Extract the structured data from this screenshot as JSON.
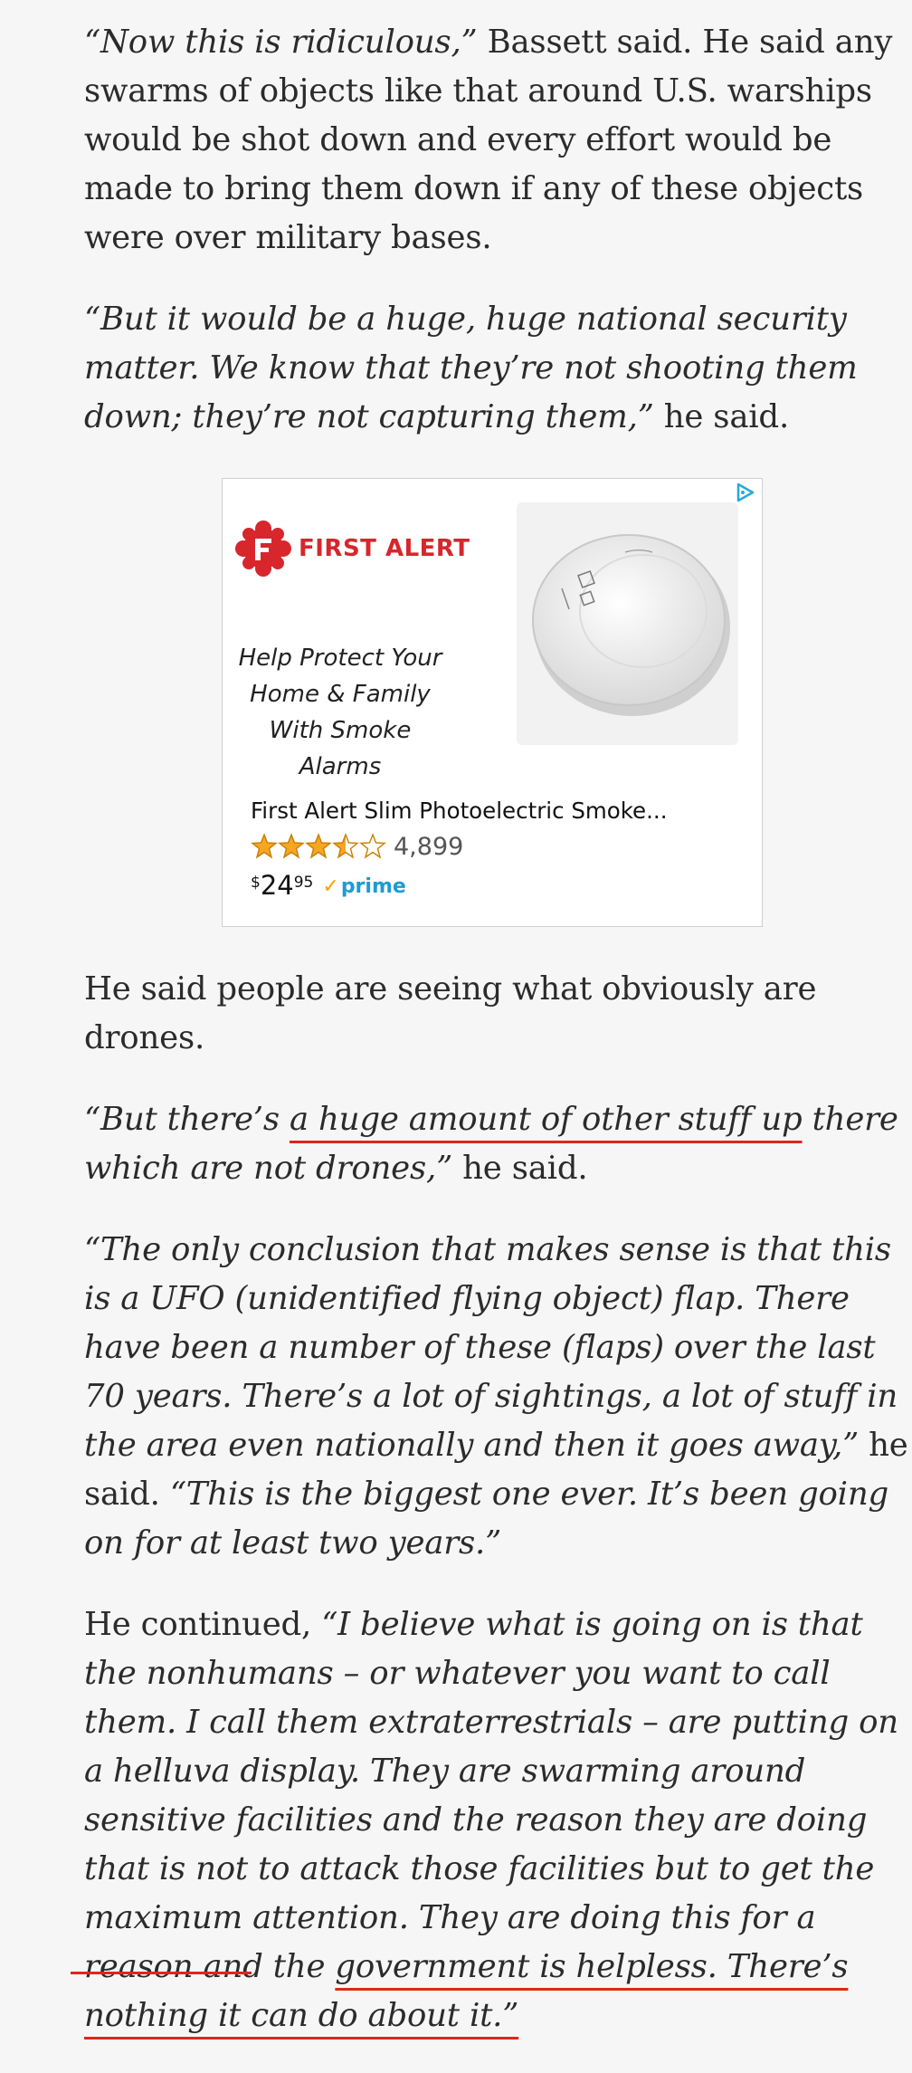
{
  "article": {
    "p1": {
      "quote": "“Now this is ridiculous,”",
      "rest": " Bassett said. He said any swarms of objects like that around U.S. warships would be shot down and every effort would be made to bring them down if any of these objects were over military bases."
    },
    "p2": {
      "quote": "“But it would be a huge, huge national security matter. We know that they’re not shooting them down; they’re not capturing them,”",
      "rest": " he said."
    },
    "p3": "He said people are seeing what obviously are drones.",
    "p4": {
      "pre": "“But there’s ",
      "underlined": "a huge amount of other stuff up",
      "post": " there which are not drones,”",
      "rest": " he said."
    },
    "p5": {
      "quote1": "“The only conclusion that makes sense is that this is a UFO (unidentified flying object) flap. There have been a number of these (flaps) over the last 70 years. There’s a lot of sightings, a lot of stuff in the area even nationally and then it goes away,”",
      "mid": " he said. ",
      "quote2": "“This is the biggest one ever. It’s been going on for at least two years.”"
    },
    "p6": {
      "lead": "He continued, ",
      "quote": "“I believe what is going on is that the nonhumans – or whatever you want to call them. I call them extraterrestrials – are putting on a helluva display. They are swarming around sensitive facilities and the reason they are doing that is not to attack those facilities but to get the maximum attention. They are doing this for a reason and the ",
      "underlined": "government is helpless. There’s nothing it can do about it.”"
    }
  },
  "ad": {
    "brand": "FIRST ALERT",
    "tagline": "Help Protect Your Home & Family With Smoke Alarms",
    "product_title": "First Alert Slim Photoelectric Smoke...",
    "rating_stars": 4.5,
    "rating_count": "4,899",
    "price_currency": "$",
    "price_main": "24",
    "price_cents": "95",
    "prime_label": "prime",
    "brand_color": "#d7262c",
    "accent_color": "#1d9bd6",
    "icons": [
      "adchoices-icon",
      "first-alert-logo-icon",
      "smoke-alarm-image",
      "star-icon",
      "prime-check-icon"
    ]
  },
  "annotation_color": "#e0261b"
}
